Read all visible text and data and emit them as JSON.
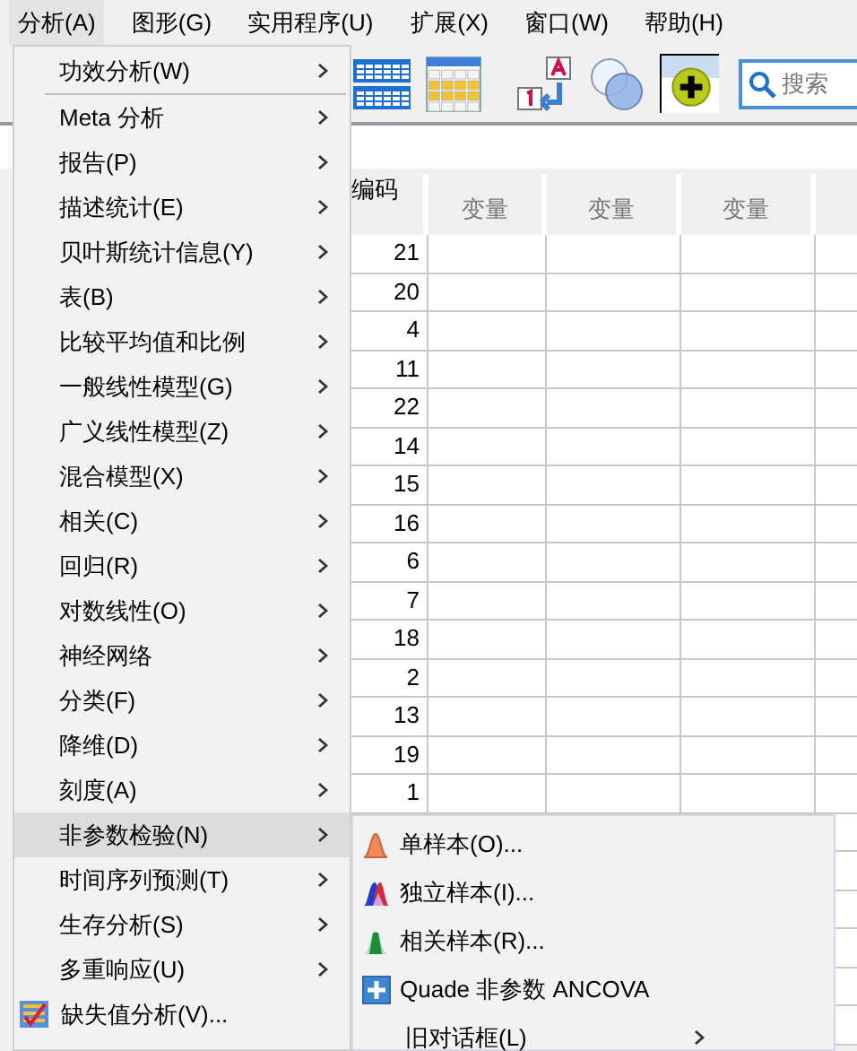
{
  "menu_bar": [
    {
      "label": "分析(A)",
      "selected": true
    },
    {
      "label": "图形(G)",
      "selected": false
    },
    {
      "label": "实用程序(U)",
      "selected": false
    },
    {
      "label": "扩展(X)",
      "selected": false
    },
    {
      "label": "窗口(W)",
      "selected": false
    },
    {
      "label": "帮助(H)",
      "selected": false
    }
  ],
  "search": {
    "placeholder": "搜索"
  },
  "grid": {
    "columns": [
      "编码",
      "变量",
      "变量",
      "变量"
    ],
    "rows": [
      "21",
      "20",
      "4",
      "11",
      "22",
      "14",
      "15",
      "16",
      "6",
      "7",
      "18",
      "2",
      "13",
      "19",
      "1"
    ]
  },
  "menu": {
    "items": [
      {
        "kind": "submenu",
        "label": "功效分析(W)",
        "selected": false
      },
      {
        "kind": "separator"
      },
      {
        "kind": "submenu",
        "label": "Meta 分析",
        "selected": false
      },
      {
        "kind": "submenu",
        "label": "报告(P)",
        "selected": false
      },
      {
        "kind": "submenu",
        "label": "描述统计(E)",
        "selected": false
      },
      {
        "kind": "submenu",
        "label": "贝叶斯统计信息(Y)",
        "selected": false
      },
      {
        "kind": "submenu",
        "label": "表(B)",
        "selected": false
      },
      {
        "kind": "submenu",
        "label": "比较平均值和比例",
        "selected": false
      },
      {
        "kind": "submenu",
        "label": "一般线性模型(G)",
        "selected": false
      },
      {
        "kind": "submenu",
        "label": "广义线性模型(Z)",
        "selected": false
      },
      {
        "kind": "submenu",
        "label": "混合模型(X)",
        "selected": false
      },
      {
        "kind": "submenu",
        "label": "相关(C)",
        "selected": false
      },
      {
        "kind": "submenu",
        "label": "回归(R)",
        "selected": false
      },
      {
        "kind": "submenu",
        "label": "对数线性(O)",
        "selected": false
      },
      {
        "kind": "submenu",
        "label": "神经网络",
        "selected": false
      },
      {
        "kind": "submenu",
        "label": "分类(F)",
        "selected": false
      },
      {
        "kind": "submenu",
        "label": "降维(D)",
        "selected": false
      },
      {
        "kind": "submenu",
        "label": "刻度(A)",
        "selected": false
      },
      {
        "kind": "submenu",
        "label": "非参数检验(N)",
        "selected": true
      },
      {
        "kind": "submenu",
        "label": "时间序列预测(T)",
        "selected": false
      },
      {
        "kind": "submenu",
        "label": "生存分析(S)",
        "selected": false
      },
      {
        "kind": "submenu",
        "label": "多重响应(U)",
        "selected": false
      },
      {
        "kind": "command",
        "label": "缺失值分析(V)...",
        "selected": false
      }
    ]
  },
  "submenu": {
    "items": [
      {
        "kind": "command",
        "label": "单样本(O)...",
        "selected": false
      },
      {
        "kind": "command",
        "label": "独立样本(I)...",
        "selected": false
      },
      {
        "kind": "command",
        "label": "相关样本(R)...",
        "selected": false
      },
      {
        "kind": "command",
        "label": "Quade 非参数 ANCOVA",
        "selected": false
      },
      {
        "kind": "submenu",
        "label": "旧对话框(L)",
        "selected": false
      }
    ]
  }
}
